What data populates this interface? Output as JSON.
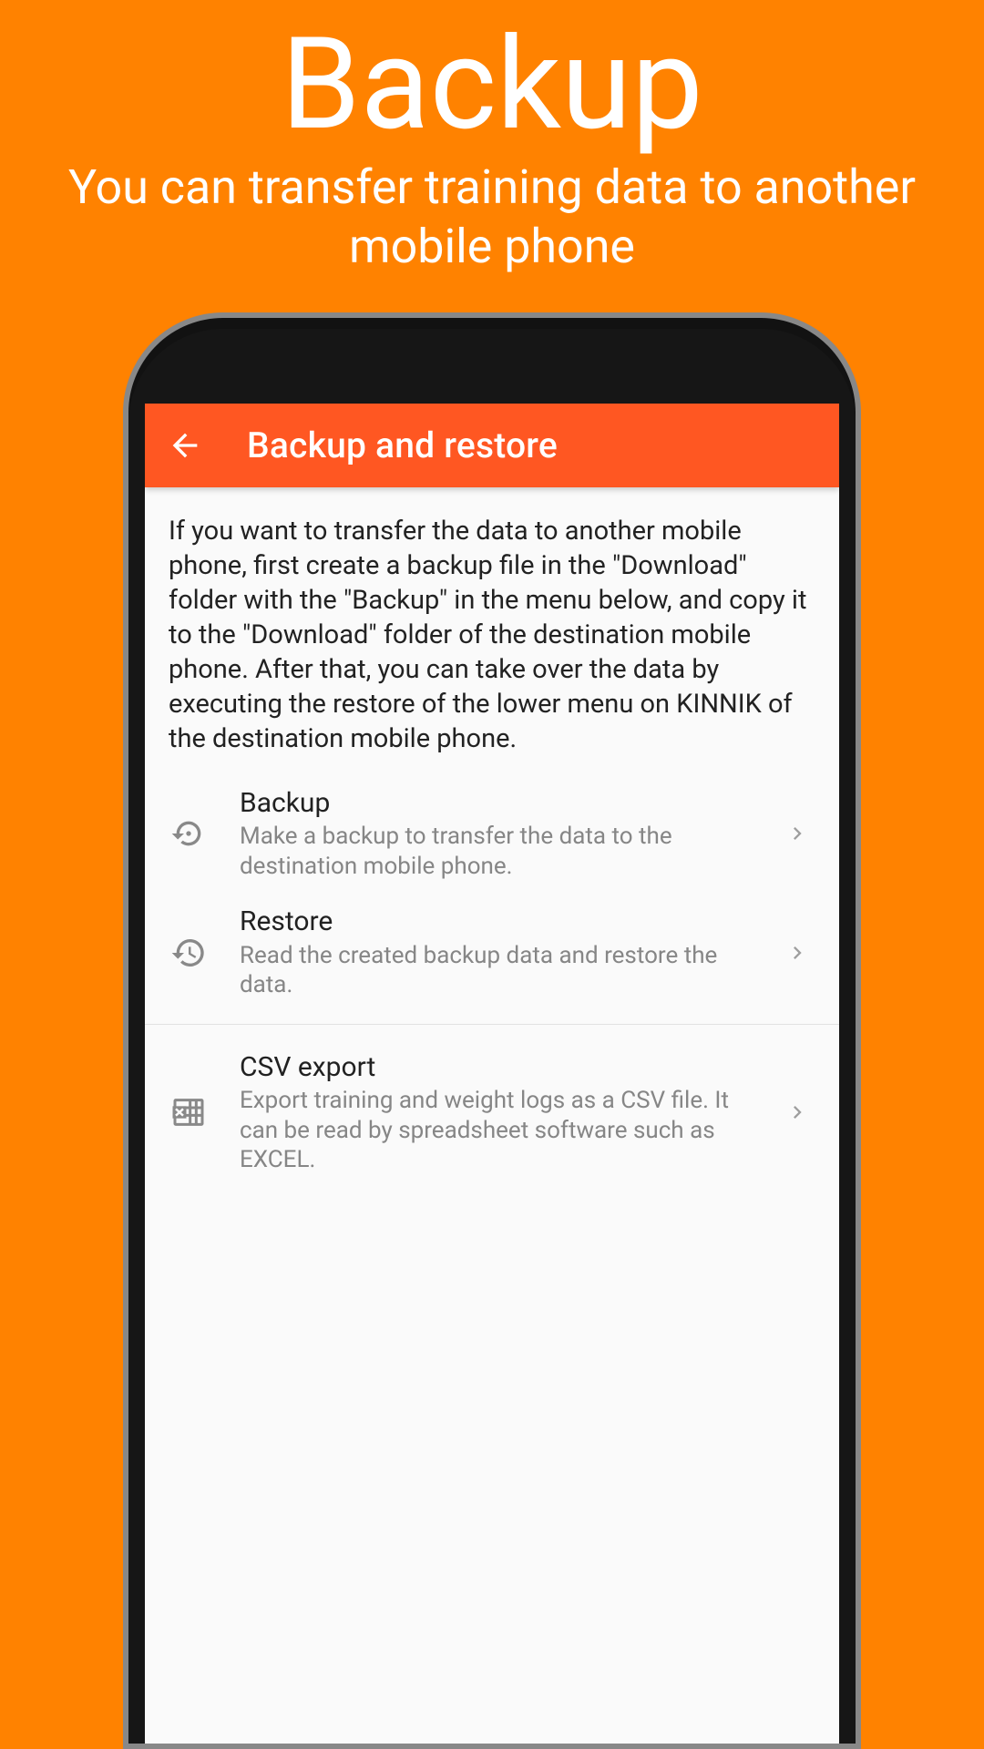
{
  "hero": {
    "title": "Backup",
    "subtitle": "You can transfer training data to another mobile phone"
  },
  "appbar": {
    "title": "Backup and restore"
  },
  "description": "If you want to transfer the data to another mobile phone, first create a backup file in the \"Download\" folder with the \"Backup\" in the menu below, and copy it to the \"Download\" folder of the destination mobile phone. After that, you can take over the data by executing the restore of the lower menu on KINNIK of the destination mobile phone.",
  "items": {
    "backup": {
      "title": "Backup",
      "subtitle": "Make a backup to transfer the data to the destination mobile phone."
    },
    "restore": {
      "title": "Restore",
      "subtitle": "Read the created backup data and restore the data."
    },
    "csv": {
      "title": "CSV export",
      "subtitle": "Export training and weight logs as a CSV file. It can be read by spreadsheet software such as EXCEL."
    }
  }
}
